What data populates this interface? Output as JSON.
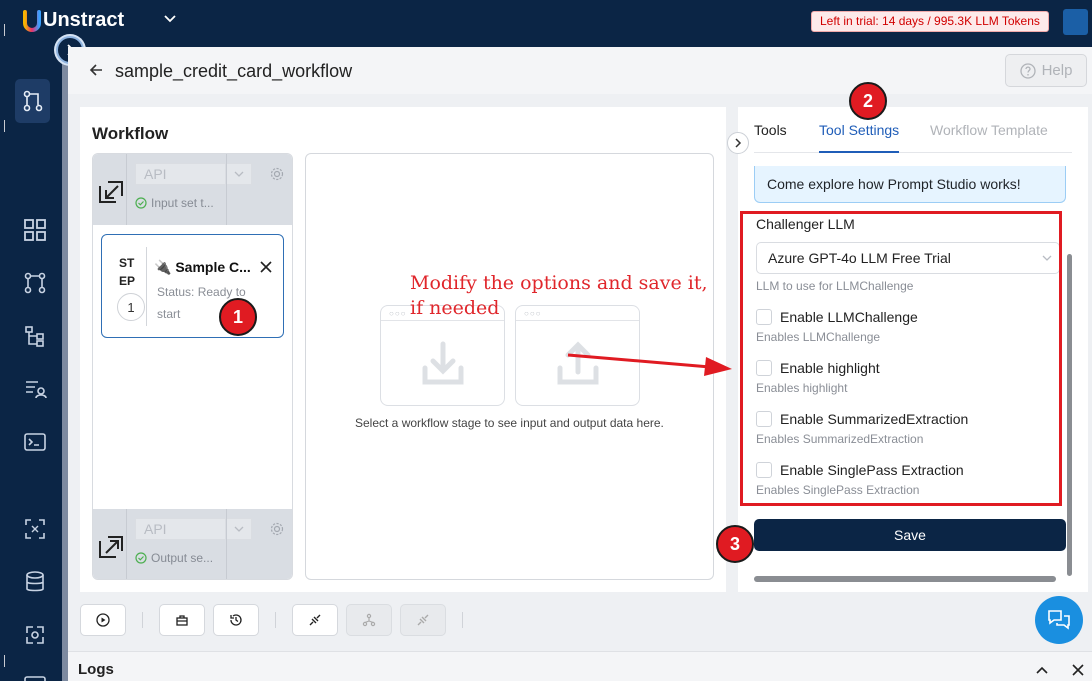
{
  "app": {
    "logo_text": "Unstract",
    "logo_letter": "U",
    "trial_text": "Left in trial: 14 days / 995.3K LLM Tokens"
  },
  "header": {
    "workflow_title": "sample_credit_card_workflow",
    "help_label": "Help"
  },
  "workflow": {
    "heading": "Workflow",
    "input": {
      "connector": "API",
      "status": "Input set t..."
    },
    "output": {
      "connector": "API",
      "status": "Output se..."
    },
    "step": {
      "label_line1": "ST",
      "label_line2": "EP",
      "number": "1",
      "name": "🔌 Sample C...",
      "status": "Status: Ready to start"
    },
    "io_hint": "Select a workflow stage to see input and output data here."
  },
  "annotation": {
    "text_line1": "Modify the options and save it,",
    "text_line2": "if needed",
    "markers": [
      "1",
      "2",
      "3"
    ]
  },
  "settings": {
    "tabs": [
      "Tools",
      "Tool Settings",
      "Workflow Template"
    ],
    "active_tab": "Tool Settings",
    "promo_text": "Come explore how Prompt Studio works!",
    "llm_label": "Challenger LLM",
    "llm_value": "Azure GPT-4o LLM Free Trial",
    "llm_help": "LLM to use for LLMChallenge",
    "options": [
      {
        "label": "Enable LLMChallenge",
        "help": "Enables LLMChallenge",
        "checked": false
      },
      {
        "label": "Enable highlight",
        "help": "Enables highlight",
        "checked": false
      },
      {
        "label": "Enable SummarizedExtraction",
        "help": "Enables SummarizedExtraction",
        "checked": false
      },
      {
        "label": "Enable SinglePass Extraction",
        "help": "Enables SinglePass Extraction",
        "checked": false
      }
    ],
    "save_label": "Save"
  },
  "logs": {
    "title": "Logs"
  },
  "colors": {
    "navy": "#0b2545",
    "accent_blue": "#1f5db8",
    "annotation_red": "#e01b22",
    "trial_red": "#d10000"
  }
}
